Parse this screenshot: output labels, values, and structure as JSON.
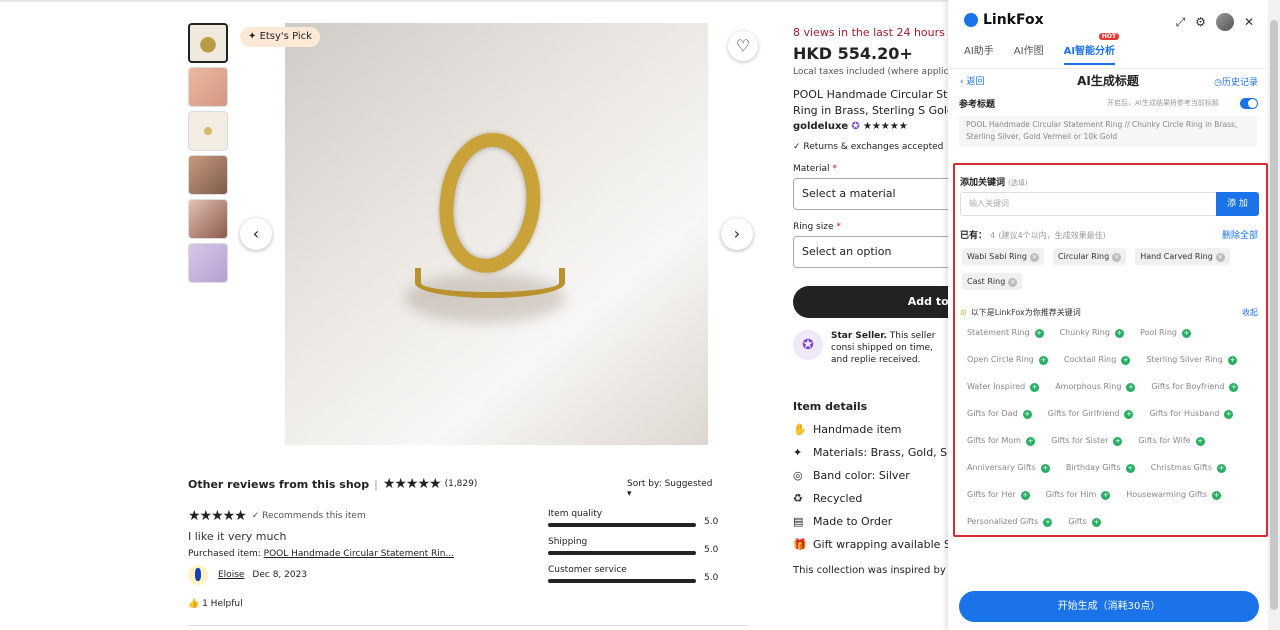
{
  "gallery": {
    "badge": "Etsy's Pick",
    "prev_icon": "chevron-left",
    "next_icon": "chevron-right",
    "favorite_icon": "heart"
  },
  "reviews": {
    "title": "Other reviews from this shop",
    "count": "(1,829)",
    "sort": "Sort by: Suggested",
    "recommends": "✓ Recommends this item",
    "text": "I like it very much",
    "purchased_label": "Purchased item: ",
    "purchased_item": "POOL Handmade Circular Statement Rin...",
    "reviewer": "Eloise",
    "date": "Dec 8, 2023",
    "helpful": "1 Helpful",
    "ratings": [
      {
        "label": "Item quality",
        "value": "5.0"
      },
      {
        "label": "Shipping",
        "value": "5.0"
      },
      {
        "label": "Customer service",
        "value": "5.0"
      }
    ]
  },
  "product": {
    "views": "8 views in the last 24 hours",
    "price": "HKD 554.20+",
    "tax": "Local taxes included (where applicab",
    "title": "POOL Handmade Circular Stat Circle Ring in Brass, Sterling S Gold",
    "shop": "goldeluxe",
    "returns": "Returns & exchanges accepted",
    "material_label": "Material",
    "material_placeholder": "Select a material",
    "size_label": "Ring size",
    "size_placeholder": "Select an option",
    "add_to_cart": "Add to c",
    "star_seller_bold": "Star Seller.",
    "star_seller_text": " This seller consi shipped on time, and replie received.",
    "details_title": "Item details",
    "details": [
      {
        "icon": "hand-icon",
        "text": "Handmade item"
      },
      {
        "icon": "sparkle-icon",
        "text": "Materials: Brass, Gold, Silv"
      },
      {
        "icon": "ring-icon",
        "text": "Band color: Silver"
      },
      {
        "icon": "recycle-icon",
        "text": "Recycled"
      },
      {
        "icon": "clipboard-icon",
        "text": "Made to Order"
      },
      {
        "icon": "gift-icon",
        "text": "Gift wrapping available  Se"
      }
    ],
    "collection": "This collection was inspired by"
  },
  "linkfox": {
    "brand": "LinkFox",
    "tabs": [
      {
        "label": "AI助手"
      },
      {
        "label": "AI作图"
      },
      {
        "label": "AI智能分析",
        "badge": "HOT"
      }
    ],
    "back": "返回",
    "title": "AI生成标题",
    "history": "历史记录",
    "ref_label": "参考标题",
    "ref_hint": "开启后，AI生成结果将参考当前标题",
    "ref_text": "POOL Handmade Circular Statement Ring // Chunky Circle Ring in Brass, Sterling Silver, Gold Vermeil or 10k Gold",
    "kw_label": "添加关键词",
    "kw_optional": "(选填)",
    "kw_placeholder": "输入关键词",
    "add_btn": "添 加",
    "have_label": "已有：",
    "have_count": "4",
    "have_hint": "(建议4个以内，生成效果最佳)",
    "delete_all": "删除全部",
    "selected": [
      "Wabi Sabi Ring",
      "Circular Ring",
      "Hand Carved Ring",
      "Cast Ring"
    ],
    "rec_head": "以下是LinkFox为你推荐关键词",
    "collapse": "收起",
    "recommended": [
      "Statement Ring",
      "Chunky Ring",
      "Pool Ring",
      "Open Circle Ring",
      "Cocktail Ring",
      "Sterling Silver Ring",
      "Water Inspired",
      "Amorphous Ring",
      "Gifts for Boyfriend",
      "Gifts for Dad",
      "Gifts for Girlfriend",
      "Gifts for Husband",
      "Gifts for Mom",
      "Gifts for Sister",
      "Gifts for Wife",
      "Anniversary Gifts",
      "Birthday Gifts",
      "Christmas Gifts",
      "Gifts for Her",
      "Gifts for Him",
      "Housewarming Gifts",
      "Personalized Gifts",
      "Gifts"
    ],
    "generate": "开始生成（消耗30点）"
  }
}
